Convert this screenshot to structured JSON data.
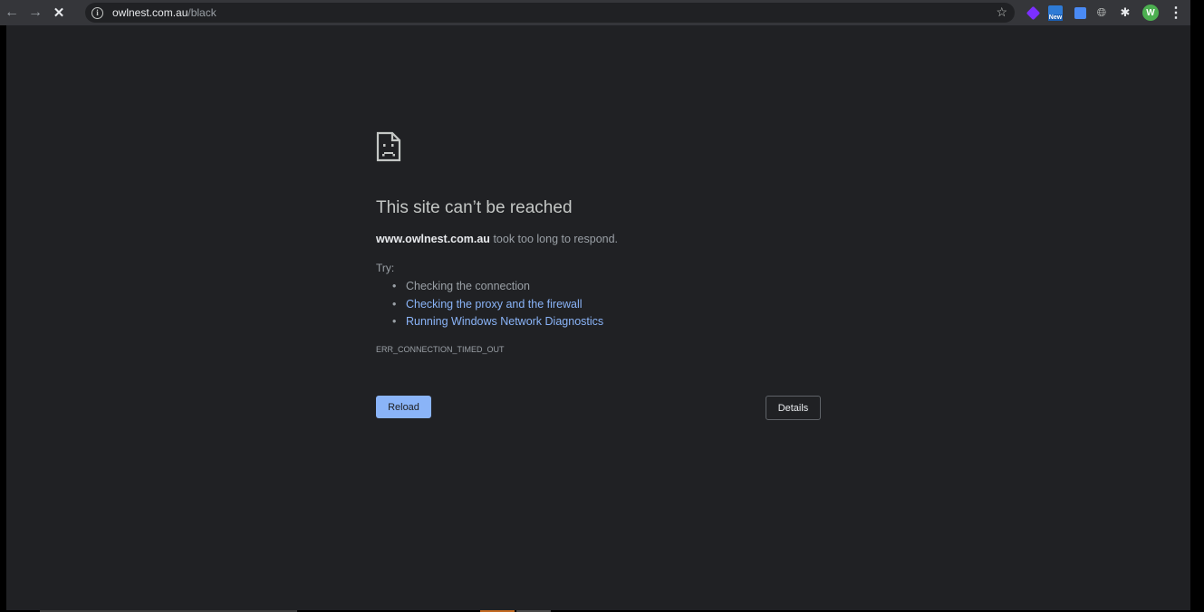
{
  "browser": {
    "url_host": "owlnest.com.au",
    "url_path": "/black"
  },
  "icons": {
    "back": "arrow-left-icon",
    "forward": "arrow-right-icon",
    "stop": "close-icon",
    "site_info": "info-icon",
    "bookmark": "star-icon",
    "extensions": "puzzle-icon",
    "menu": "kebab-menu-icon"
  },
  "extensions": {
    "new_badge": "New"
  },
  "profile": {
    "initial": "W",
    "color": "#4caf50"
  },
  "error_page": {
    "title": "This site can’t be reached",
    "host": "www.owlnest.com.au",
    "message": "took too long to respond.",
    "try_label": "Try:",
    "suggestions": [
      "Checking the connection",
      "Checking the proxy and the firewall",
      "Running Windows Network Diagnostics"
    ],
    "error_code": "ERR_CONNECTION_TIMED_OUT",
    "reload_label": "Reload",
    "details_label": "Details"
  },
  "colors": {
    "page_bg": "#202124",
    "toolbar_bg": "#35363a",
    "link": "#8ab4f8",
    "title": "#c4c7c5",
    "text": "#9aa0a6"
  }
}
